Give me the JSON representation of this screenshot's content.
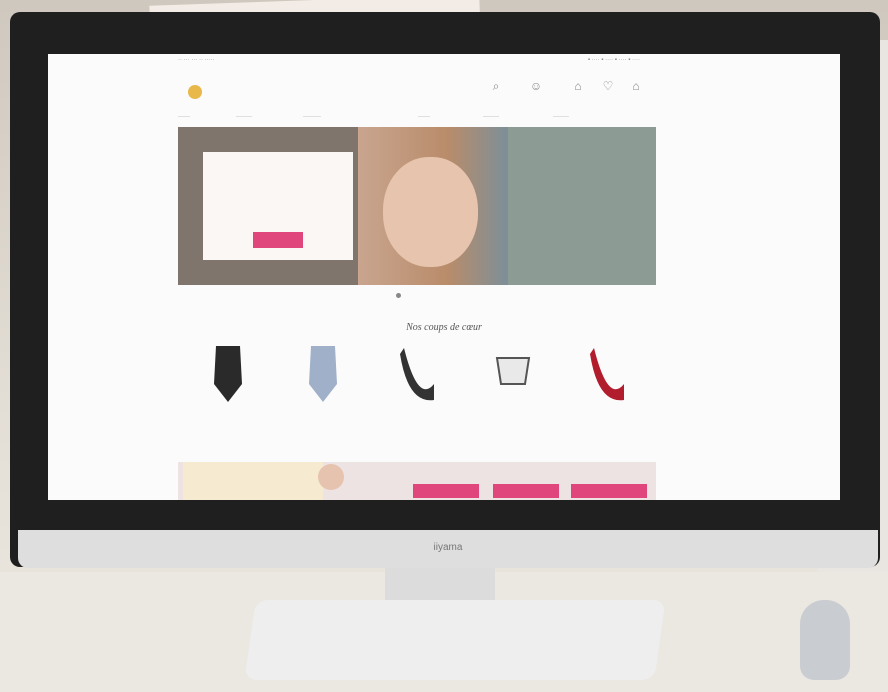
{
  "chin": {
    "logo": "iiyama"
  },
  "site": {
    "header": {
      "logo_text": "",
      "tagline": ""
    },
    "hero": {
      "title": "",
      "body": "",
      "cta": ""
    },
    "section_title": "Nos coups de cœur",
    "products": [
      {
        "name": "",
        "price": ""
      },
      {
        "name": "",
        "price": ""
      },
      {
        "name": "",
        "price": ""
      },
      {
        "name": "",
        "price": ""
      },
      {
        "name": "",
        "price": ""
      }
    ],
    "banner": {
      "title": "",
      "buttons": [
        "",
        "",
        ""
      ]
    }
  },
  "colors": {
    "accent": "#e0457c",
    "logo": "#e8b84a"
  }
}
